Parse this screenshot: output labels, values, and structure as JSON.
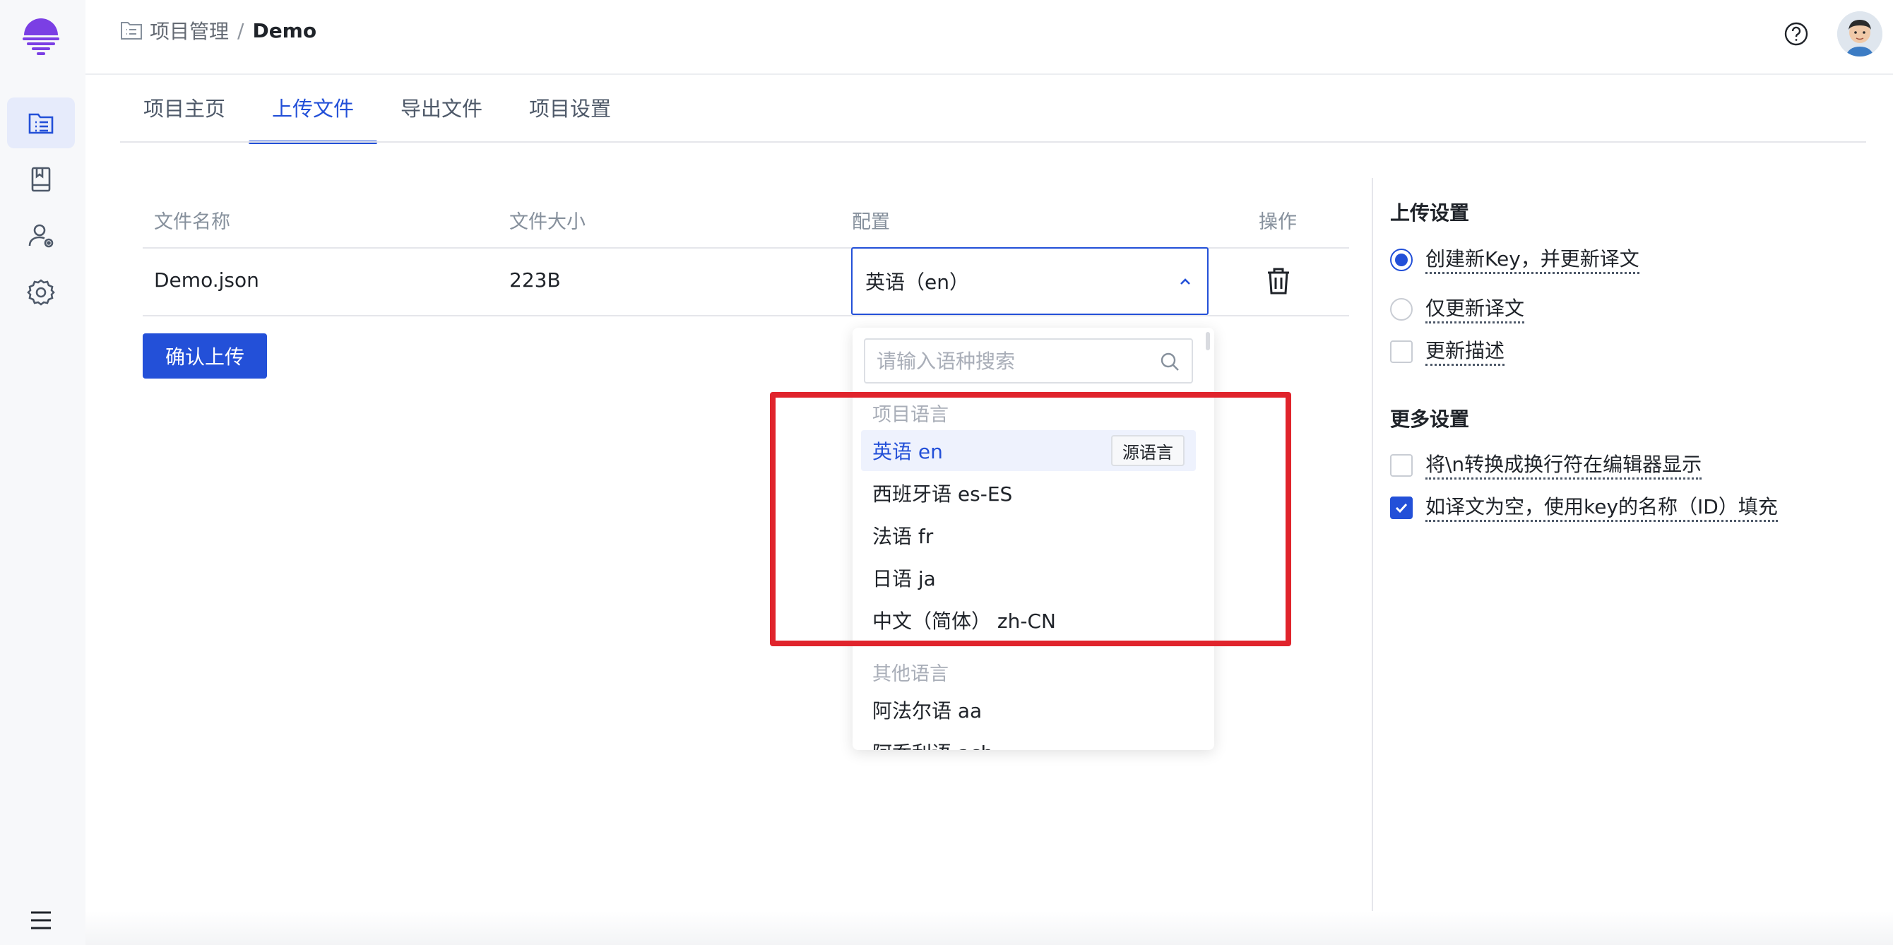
{
  "breadcrumb": {
    "root": "项目管理",
    "separator": "/",
    "current": "Demo"
  },
  "tabs": [
    {
      "label": "项目主页",
      "active": false
    },
    {
      "label": "上传文件",
      "active": true
    },
    {
      "label": "导出文件",
      "active": false
    },
    {
      "label": "项目设置",
      "active": false
    }
  ],
  "table": {
    "headers": {
      "name": "文件名称",
      "size": "文件大小",
      "config": "配置",
      "action": "操作"
    },
    "rows": [
      {
        "name": "Demo.json",
        "size": "223B",
        "config": "英语（en）"
      }
    ]
  },
  "confirm_label": "确认上传",
  "dropdown": {
    "search_placeholder": "请输入语种搜索",
    "project_group": "项目语言",
    "project_languages": [
      {
        "label": "英语 en",
        "selected": true,
        "tag": "源语言"
      },
      {
        "label": "西班牙语 es-ES"
      },
      {
        "label": "法语 fr"
      },
      {
        "label": "日语 ja"
      },
      {
        "label": "中文（简体） zh-CN"
      }
    ],
    "other_group": "其他语言",
    "other_languages": [
      {
        "label": "阿法尔语 aa"
      },
      {
        "label": "阿乔利语 ach"
      }
    ]
  },
  "upload_settings": {
    "title": "上传设置",
    "options": [
      {
        "type": "radio",
        "label": "创建新Key，并更新译文",
        "checked": true
      },
      {
        "type": "radio",
        "label": "仅更新译文",
        "checked": false
      },
      {
        "type": "checkbox",
        "label": "更新描述",
        "checked": false
      }
    ]
  },
  "more_settings": {
    "title": "更多设置",
    "options": [
      {
        "type": "checkbox",
        "label": "将\\n转换成换行符在编辑器显示",
        "checked": false
      },
      {
        "type": "checkbox",
        "label": "如译文为空，使用key的名称（ID）填充",
        "checked": true
      }
    ]
  },
  "colors": {
    "accent": "#2350d8",
    "highlight": "#e0242c",
    "logo": "#7b3fe4"
  },
  "icons": {
    "sidebar": [
      "project-list-icon",
      "book-icon",
      "user-settings-icon",
      "gear-icon"
    ],
    "menu": "hamburger-menu-icon",
    "help": "help-icon",
    "search": "search-icon",
    "delete": "trash-icon"
  }
}
